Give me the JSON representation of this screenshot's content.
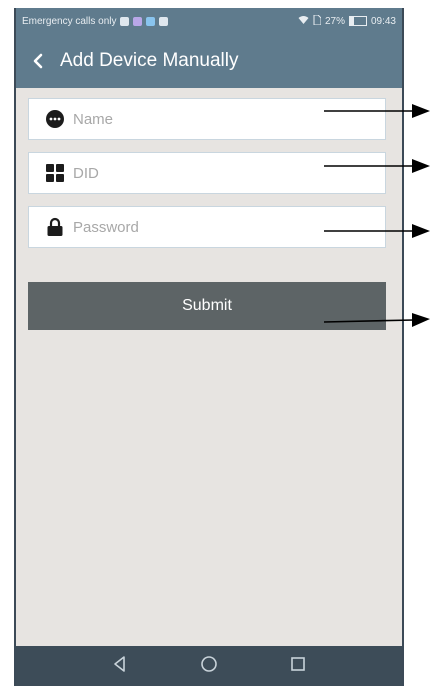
{
  "status_bar": {
    "carrier_text": "Emergency calls only",
    "battery_percent": "27%",
    "battery_level": 0.27,
    "time": "09:43"
  },
  "app_bar": {
    "back_icon": "chevron-left-icon",
    "title": "Add Device Manually"
  },
  "form": {
    "name": {
      "icon": "chat-bubble-icon",
      "placeholder": "Name",
      "value": ""
    },
    "did": {
      "icon": "grid-icon",
      "placeholder": "DID",
      "value": ""
    },
    "password": {
      "icon": "lock-icon",
      "placeholder": "Password",
      "value": ""
    },
    "submit_label": "Submit"
  },
  "nav_bar": {
    "icons": [
      "back-triangle-icon",
      "home-circle-icon",
      "recents-square-icon"
    ]
  },
  "colors": {
    "app_bar": "#5f7b8d",
    "background": "#e7e4e1",
    "submit_button": "#5d6466",
    "nav_bar": "#3d4c58"
  }
}
